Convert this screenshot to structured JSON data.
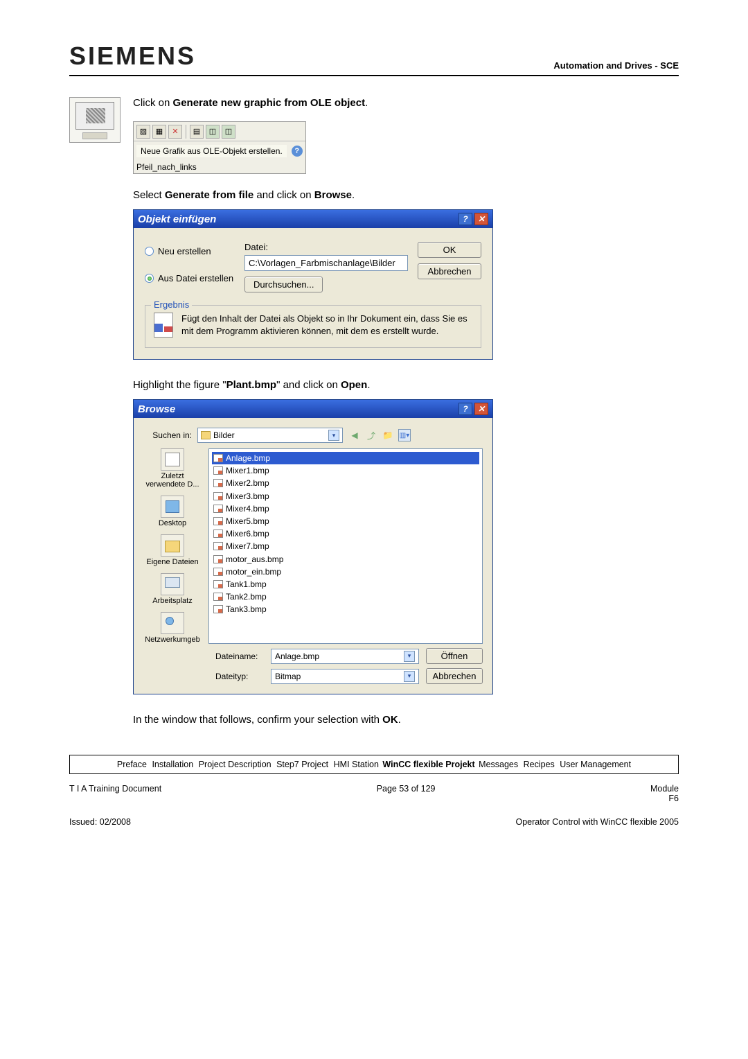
{
  "header": {
    "logo": "SIEMENS",
    "right": "Automation and Drives - SCE"
  },
  "para1": {
    "pre": "Click on ",
    "bold": "Generate new graphic from OLE object",
    "post": "."
  },
  "toolbar": {
    "tooltip": "Neue Grafik aus OLE-Objekt erstellen.",
    "sub": "Pfeil_nach_links"
  },
  "para2": {
    "pre": "Select ",
    "bold": "Generate from file",
    "mid": " and click on ",
    "bold2": "Browse",
    "post": "."
  },
  "dlg1": {
    "title": "Objekt einfügen",
    "radio1": "Neu erstellen",
    "radio2": "Aus Datei erstellen",
    "fileLabel": "Datei:",
    "filePath": "C:\\Vorlagen_Farbmischanlage\\Bilder",
    "browseBtn": "Durchsuchen...",
    "okBtn": "OK",
    "cancelBtn": "Abbrechen",
    "resultLegend": "Ergebnis",
    "resultText": "Fügt den Inhalt der Datei als Objekt so in Ihr Dokument ein, dass Sie es mit dem Programm aktivieren können, mit dem es erstellt wurde."
  },
  "para3": {
    "pre": "Highlight the figure \"",
    "bold": "Plant.bmp",
    "mid": "\" and click on ",
    "bold2": "Open",
    "post": "."
  },
  "dlg2": {
    "title": "Browse",
    "searchInLabel": "Suchen in:",
    "searchInValue": "Bilder",
    "places": [
      "Zuletzt verwendete D...",
      "Desktop",
      "Eigene Dateien",
      "Arbeitsplatz",
      "Netzwerkumgeb"
    ],
    "files": [
      "Anlage.bmp",
      "Mixer1.bmp",
      "Mixer2.bmp",
      "Mixer3.bmp",
      "Mixer4.bmp",
      "Mixer5.bmp",
      "Mixer6.bmp",
      "Mixer7.bmp",
      "motor_aus.bmp",
      "motor_ein.bmp",
      "Tank1.bmp",
      "Tank2.bmp",
      "Tank3.bmp"
    ],
    "selectedIndex": 0,
    "filenameLabel": "Dateiname:",
    "filenameValue": "Anlage.bmp",
    "filetypeLabel": "Dateityp:",
    "filetypeValue": "Bitmap",
    "openBtn": "Öffnen",
    "cancelBtn": "Abbrechen"
  },
  "para4": {
    "pre": "In the window that follows, confirm your selection with ",
    "bold": "OK",
    "post": "."
  },
  "nav": {
    "items": [
      "Preface",
      "Installation",
      "Project Description",
      "Step7 Project",
      "HMI Station",
      "WinCC flexible Projekt",
      "Messages",
      "Recipes",
      "User Management"
    ],
    "activeIndex": 5
  },
  "footer": {
    "leftTop": "T I A  Training Document",
    "centerTop": "Page 53 of 129",
    "rightTop1": "Module",
    "rightTop2": "F6",
    "leftBot": "Issued: 02/2008",
    "rightBot": "Operator Control with WinCC flexible 2005"
  }
}
